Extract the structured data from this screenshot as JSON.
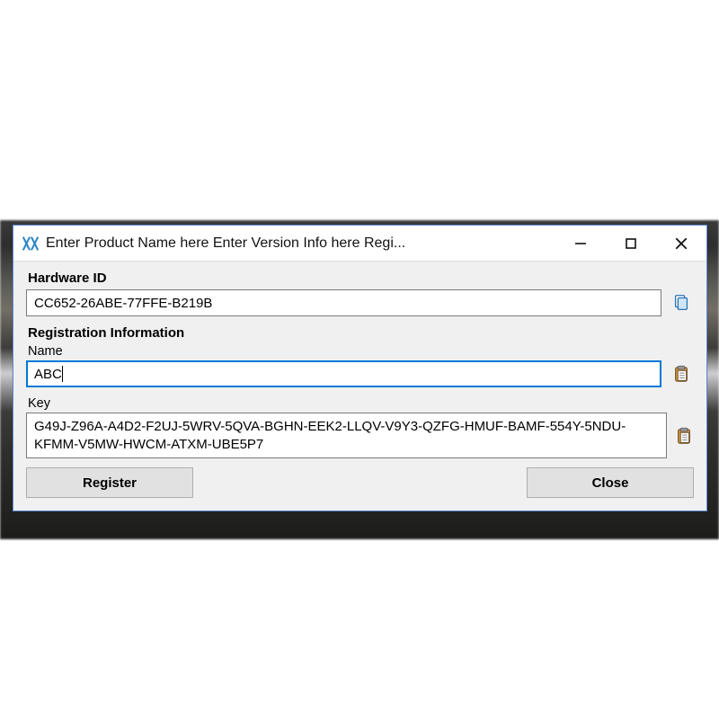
{
  "window": {
    "title": "Enter Product Name here Enter Version Info here Regi..."
  },
  "hardware": {
    "label": "Hardware ID",
    "value": "CC652-26ABE-77FFE-B219B"
  },
  "reg": {
    "section_label": "Registration Information",
    "name_label": "Name",
    "name_value": "ABC",
    "key_label": "Key",
    "key_value": "G49J-Z96A-A4D2-F2UJ-5WRV-5QVA-BGHN-EEK2-LLQV-V9Y3-QZFG-HMUF-BAMF-554Y-5NDU-KFMM-V5MW-HWCM-ATXM-UBE5P7"
  },
  "buttons": {
    "register": "Register",
    "close": "Close"
  }
}
